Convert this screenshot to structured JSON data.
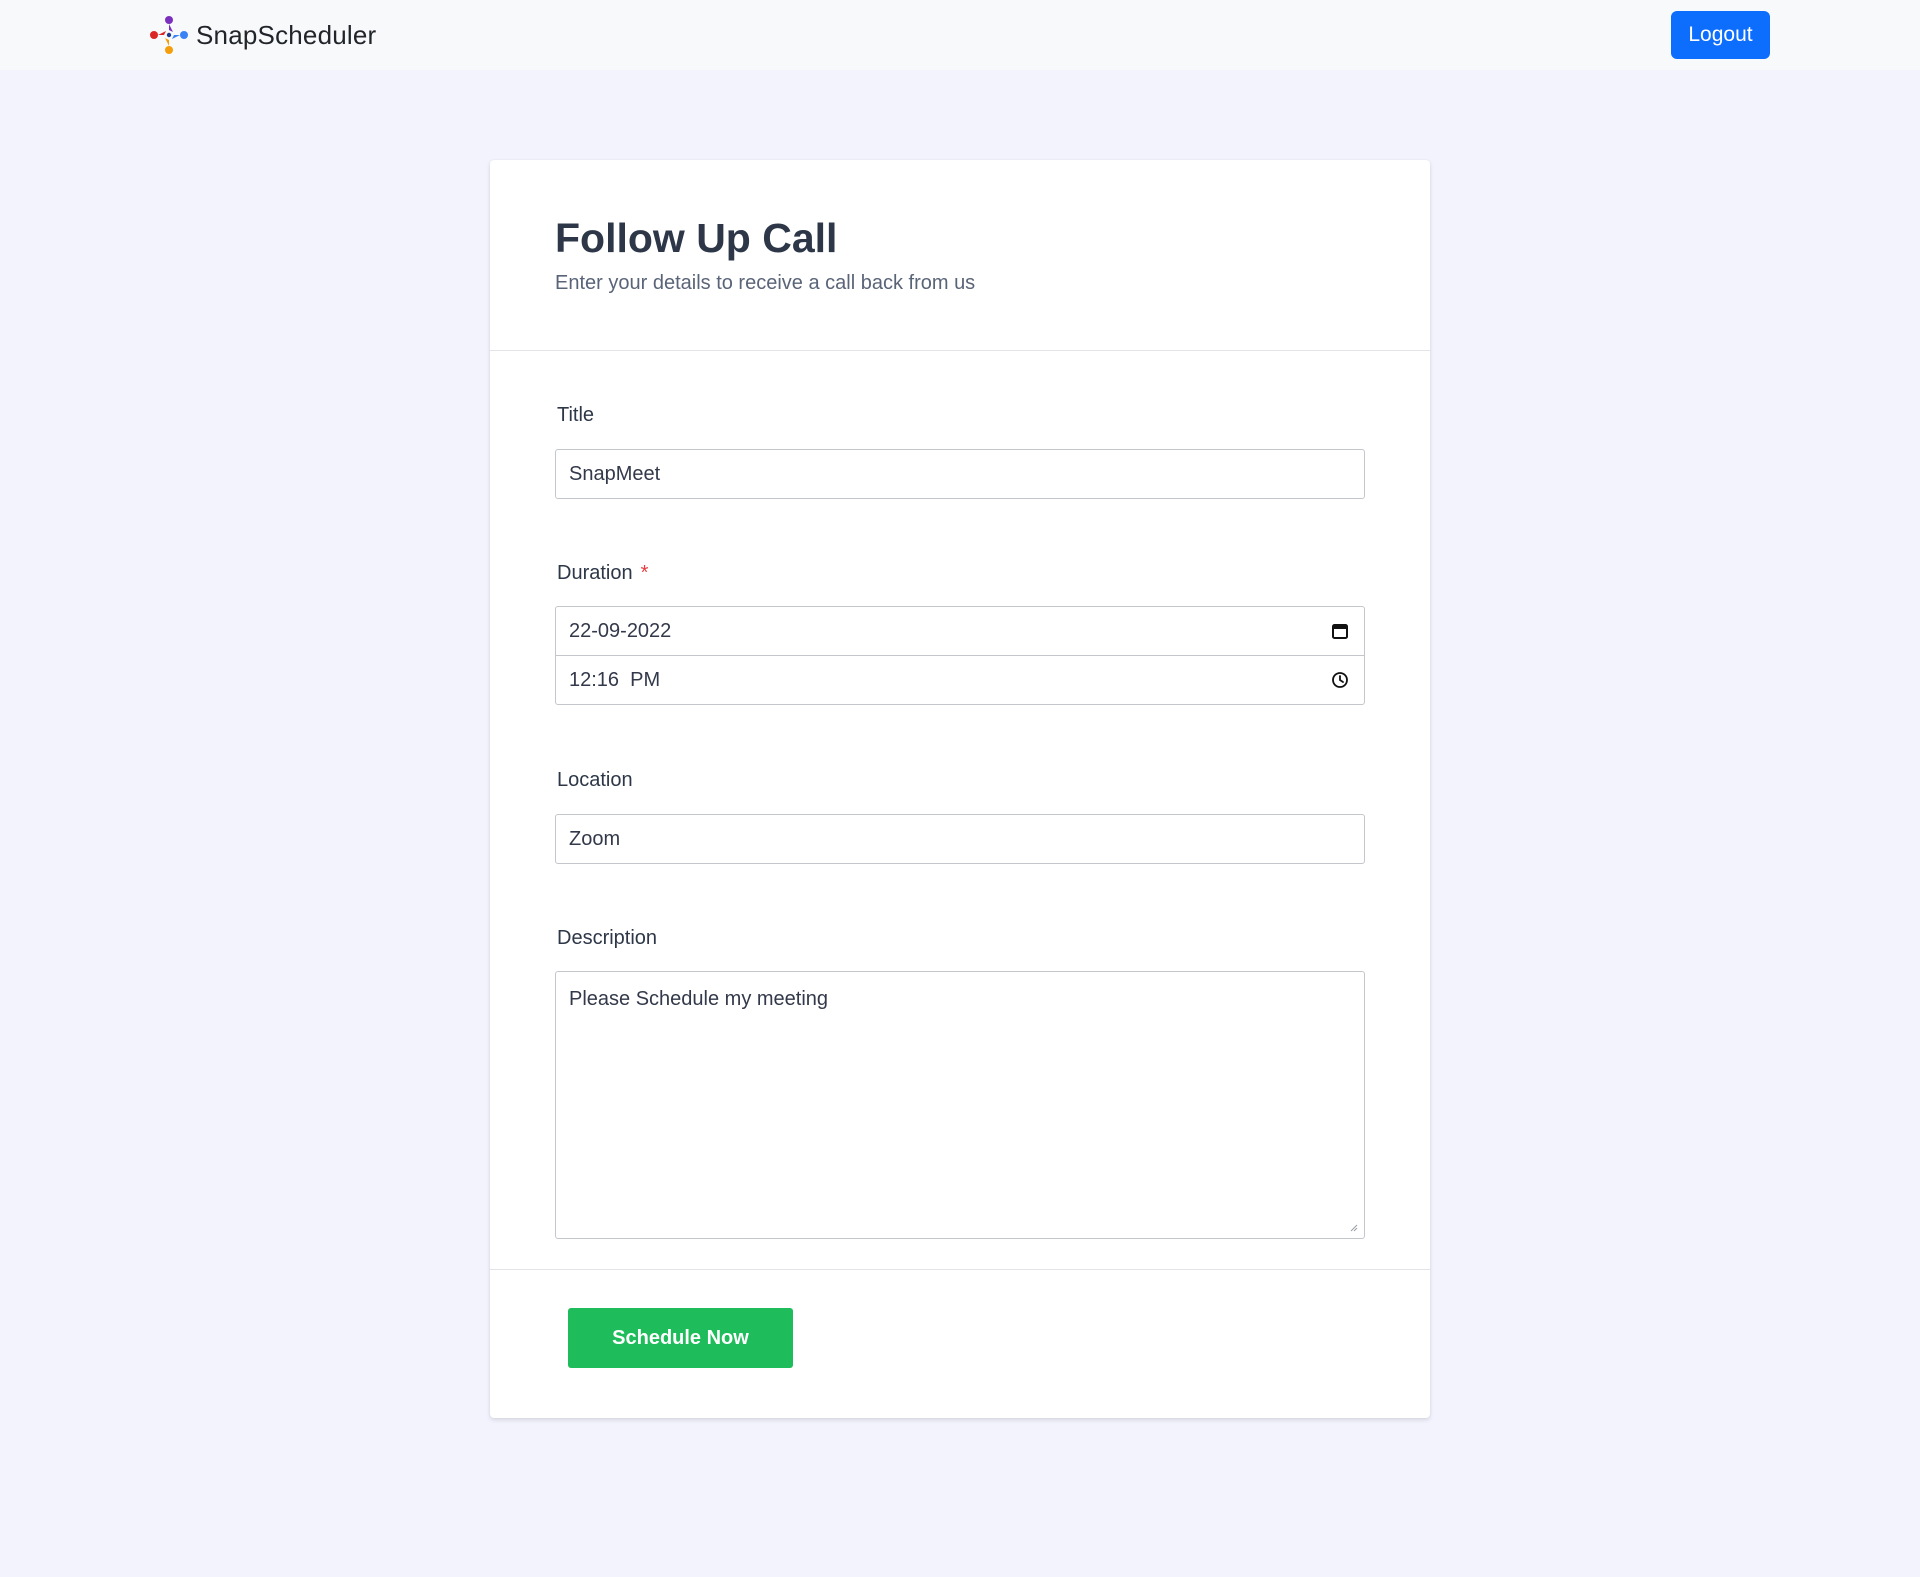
{
  "navbar": {
    "brand_name": "SnapScheduler",
    "logo_icon": "snapscheduler-logo-icon",
    "logout_label": "Logout",
    "logout_color": "#0d6efd"
  },
  "card": {
    "title": "Follow Up Call",
    "subtitle": "Enter your details to receive a call back from us"
  },
  "form": {
    "title": {
      "label": "Title",
      "value": "SnapMeet"
    },
    "duration": {
      "label": "Duration",
      "required_mark": "*",
      "date_value": "22-09-2022",
      "date_icon": "calendar-icon",
      "time_value": "12:16  PM",
      "time_icon": "clock-icon"
    },
    "location": {
      "label": "Location",
      "value": "Zoom"
    },
    "description": {
      "label": "Description",
      "value": "Please Schedule my meeting"
    },
    "submit_label": "Schedule Now",
    "submit_color": "#1ebc5a"
  }
}
